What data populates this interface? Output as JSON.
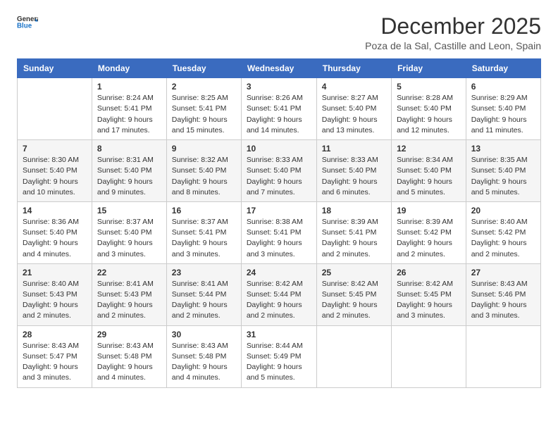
{
  "logo": {
    "line1": "General",
    "line2": "Blue"
  },
  "title": "December 2025",
  "location": "Poza de la Sal, Castille and Leon, Spain",
  "headers": [
    "Sunday",
    "Monday",
    "Tuesday",
    "Wednesday",
    "Thursday",
    "Friday",
    "Saturday"
  ],
  "weeks": [
    [
      {
        "day": "",
        "sunrise": "",
        "sunset": "",
        "daylight": ""
      },
      {
        "day": "1",
        "sunrise": "Sunrise: 8:24 AM",
        "sunset": "Sunset: 5:41 PM",
        "daylight": "Daylight: 9 hours and 17 minutes."
      },
      {
        "day": "2",
        "sunrise": "Sunrise: 8:25 AM",
        "sunset": "Sunset: 5:41 PM",
        "daylight": "Daylight: 9 hours and 15 minutes."
      },
      {
        "day": "3",
        "sunrise": "Sunrise: 8:26 AM",
        "sunset": "Sunset: 5:41 PM",
        "daylight": "Daylight: 9 hours and 14 minutes."
      },
      {
        "day": "4",
        "sunrise": "Sunrise: 8:27 AM",
        "sunset": "Sunset: 5:40 PM",
        "daylight": "Daylight: 9 hours and 13 minutes."
      },
      {
        "day": "5",
        "sunrise": "Sunrise: 8:28 AM",
        "sunset": "Sunset: 5:40 PM",
        "daylight": "Daylight: 9 hours and 12 minutes."
      },
      {
        "day": "6",
        "sunrise": "Sunrise: 8:29 AM",
        "sunset": "Sunset: 5:40 PM",
        "daylight": "Daylight: 9 hours and 11 minutes."
      }
    ],
    [
      {
        "day": "7",
        "sunrise": "Sunrise: 8:30 AM",
        "sunset": "Sunset: 5:40 PM",
        "daylight": "Daylight: 9 hours and 10 minutes."
      },
      {
        "day": "8",
        "sunrise": "Sunrise: 8:31 AM",
        "sunset": "Sunset: 5:40 PM",
        "daylight": "Daylight: 9 hours and 9 minutes."
      },
      {
        "day": "9",
        "sunrise": "Sunrise: 8:32 AM",
        "sunset": "Sunset: 5:40 PM",
        "daylight": "Daylight: 9 hours and 8 minutes."
      },
      {
        "day": "10",
        "sunrise": "Sunrise: 8:33 AM",
        "sunset": "Sunset: 5:40 PM",
        "daylight": "Daylight: 9 hours and 7 minutes."
      },
      {
        "day": "11",
        "sunrise": "Sunrise: 8:33 AM",
        "sunset": "Sunset: 5:40 PM",
        "daylight": "Daylight: 9 hours and 6 minutes."
      },
      {
        "day": "12",
        "sunrise": "Sunrise: 8:34 AM",
        "sunset": "Sunset: 5:40 PM",
        "daylight": "Daylight: 9 hours and 5 minutes."
      },
      {
        "day": "13",
        "sunrise": "Sunrise: 8:35 AM",
        "sunset": "Sunset: 5:40 PM",
        "daylight": "Daylight: 9 hours and 5 minutes."
      }
    ],
    [
      {
        "day": "14",
        "sunrise": "Sunrise: 8:36 AM",
        "sunset": "Sunset: 5:40 PM",
        "daylight": "Daylight: 9 hours and 4 minutes."
      },
      {
        "day": "15",
        "sunrise": "Sunrise: 8:37 AM",
        "sunset": "Sunset: 5:40 PM",
        "daylight": "Daylight: 9 hours and 3 minutes."
      },
      {
        "day": "16",
        "sunrise": "Sunrise: 8:37 AM",
        "sunset": "Sunset: 5:41 PM",
        "daylight": "Daylight: 9 hours and 3 minutes."
      },
      {
        "day": "17",
        "sunrise": "Sunrise: 8:38 AM",
        "sunset": "Sunset: 5:41 PM",
        "daylight": "Daylight: 9 hours and 3 minutes."
      },
      {
        "day": "18",
        "sunrise": "Sunrise: 8:39 AM",
        "sunset": "Sunset: 5:41 PM",
        "daylight": "Daylight: 9 hours and 2 minutes."
      },
      {
        "day": "19",
        "sunrise": "Sunrise: 8:39 AM",
        "sunset": "Sunset: 5:42 PM",
        "daylight": "Daylight: 9 hours and 2 minutes."
      },
      {
        "day": "20",
        "sunrise": "Sunrise: 8:40 AM",
        "sunset": "Sunset: 5:42 PM",
        "daylight": "Daylight: 9 hours and 2 minutes."
      }
    ],
    [
      {
        "day": "21",
        "sunrise": "Sunrise: 8:40 AM",
        "sunset": "Sunset: 5:43 PM",
        "daylight": "Daylight: 9 hours and 2 minutes."
      },
      {
        "day": "22",
        "sunrise": "Sunrise: 8:41 AM",
        "sunset": "Sunset: 5:43 PM",
        "daylight": "Daylight: 9 hours and 2 minutes."
      },
      {
        "day": "23",
        "sunrise": "Sunrise: 8:41 AM",
        "sunset": "Sunset: 5:44 PM",
        "daylight": "Daylight: 9 hours and 2 minutes."
      },
      {
        "day": "24",
        "sunrise": "Sunrise: 8:42 AM",
        "sunset": "Sunset: 5:44 PM",
        "daylight": "Daylight: 9 hours and 2 minutes."
      },
      {
        "day": "25",
        "sunrise": "Sunrise: 8:42 AM",
        "sunset": "Sunset: 5:45 PM",
        "daylight": "Daylight: 9 hours and 2 minutes."
      },
      {
        "day": "26",
        "sunrise": "Sunrise: 8:42 AM",
        "sunset": "Sunset: 5:45 PM",
        "daylight": "Daylight: 9 hours and 3 minutes."
      },
      {
        "day": "27",
        "sunrise": "Sunrise: 8:43 AM",
        "sunset": "Sunset: 5:46 PM",
        "daylight": "Daylight: 9 hours and 3 minutes."
      }
    ],
    [
      {
        "day": "28",
        "sunrise": "Sunrise: 8:43 AM",
        "sunset": "Sunset: 5:47 PM",
        "daylight": "Daylight: 9 hours and 3 minutes."
      },
      {
        "day": "29",
        "sunrise": "Sunrise: 8:43 AM",
        "sunset": "Sunset: 5:48 PM",
        "daylight": "Daylight: 9 hours and 4 minutes."
      },
      {
        "day": "30",
        "sunrise": "Sunrise: 8:43 AM",
        "sunset": "Sunset: 5:48 PM",
        "daylight": "Daylight: 9 hours and 4 minutes."
      },
      {
        "day": "31",
        "sunrise": "Sunrise: 8:44 AM",
        "sunset": "Sunset: 5:49 PM",
        "daylight": "Daylight: 9 hours and 5 minutes."
      },
      {
        "day": "",
        "sunrise": "",
        "sunset": "",
        "daylight": ""
      },
      {
        "day": "",
        "sunrise": "",
        "sunset": "",
        "daylight": ""
      },
      {
        "day": "",
        "sunrise": "",
        "sunset": "",
        "daylight": ""
      }
    ]
  ]
}
